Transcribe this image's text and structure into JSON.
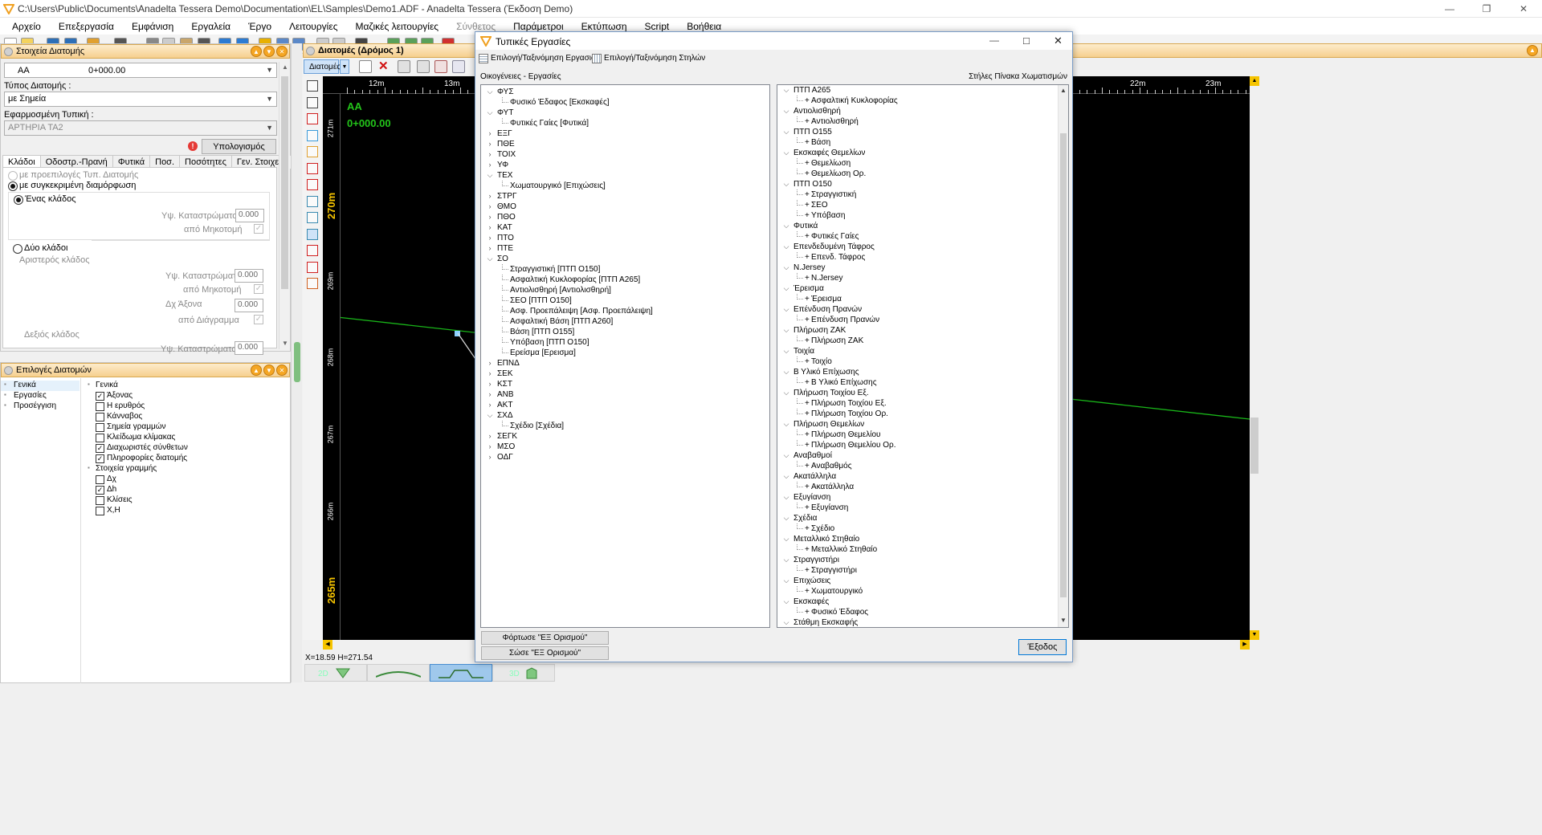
{
  "app": {
    "title": "C:\\Users\\Public\\Documents\\Anadelta Tessera Demo\\Documentation\\EL\\Samples\\Demo1.ADF - Anadelta Tessera (Έκδοση Demo)"
  },
  "menu": [
    {
      "label": "Αρχείο",
      "enabled": true
    },
    {
      "label": "Επεξεργασία",
      "enabled": true
    },
    {
      "label": "Εμφάνιση",
      "enabled": true
    },
    {
      "label": "Εργαλεία",
      "enabled": true
    },
    {
      "label": "Έργο",
      "enabled": true
    },
    {
      "label": "Λειτουργίες",
      "enabled": true
    },
    {
      "label": "Μαζικές λειτουργίες",
      "enabled": true
    },
    {
      "label": "Σύνθετος",
      "enabled": false
    },
    {
      "label": "Παράμετροι",
      "enabled": true
    },
    {
      "label": "Εκτύπωση",
      "enabled": true
    },
    {
      "label": "Script",
      "enabled": true
    },
    {
      "label": "Βοήθεια",
      "enabled": true
    }
  ],
  "left_panel": {
    "header": "Στοιχεία Διατομής",
    "section_name": "ΑΑ",
    "section_station": "0+000.00",
    "type_label": "Τύπος Διατομής :",
    "type_value": "με Σημεία",
    "applied_label": "Εφαρμοσμένη Τυπική :",
    "applied_value": "ΑΡΤΗΡΙΑ ΤΑ2",
    "calc_button": "Υπολογισμός",
    "tabs": [
      "Κλάδοι",
      "Οδοστρ.-Πρανή",
      "Φυτικά",
      "Ποσ.",
      "Ποσότητες",
      "Γεν. Στοιχεία"
    ],
    "opt_default": "με προεπιλογές Τυπ. Διατομής",
    "opt_specific": "με συγκεκριμένη διαμόρφωση",
    "one_branch": "Ένας κλάδος",
    "embankment_height": "Υψ. Καταστρώματος",
    "value_zero": "0.000",
    "from_profile": "από Μηκοτομή",
    "two_branches": "Δύο κλάδοι",
    "left_branch": "Αριστερός κλάδος",
    "dx_axis": "Δχ Άξονα",
    "from_diagram": "από Διάγραμμα",
    "right_branch": "Δεξιός κλάδος"
  },
  "options_panel": {
    "header": "Επιλογές Διατομών",
    "nav": [
      "Γενικά",
      "Εργασίες",
      "Προσέγγιση"
    ],
    "general_title": "Γενικά",
    "general_items": [
      {
        "label": "Άξονας",
        "checked": true
      },
      {
        "label": "Η ερυθρός",
        "checked": false
      },
      {
        "label": "Κάνναβος",
        "checked": false
      },
      {
        "label": "Σημεία γραμμών",
        "checked": false
      },
      {
        "label": "Κλείδωμα κλίμακας",
        "checked": false
      },
      {
        "label": "Διαχωριστές σύνθετων",
        "checked": true
      },
      {
        "label": "Πληροφορίες διατομής",
        "checked": true
      }
    ],
    "line_title": "Στοιχεία γραμμής",
    "line_items": [
      {
        "label": "Δχ",
        "checked": false
      },
      {
        "label": "Δh",
        "checked": true
      },
      {
        "label": "Κλίσεις",
        "checked": false
      },
      {
        "label": "Χ,Η",
        "checked": false
      }
    ]
  },
  "sections_window": {
    "header": "Διατομές (Δρόμος 1)",
    "dropdown": "Διατομές",
    "name": "ΑΑ",
    "station": "0+000.00",
    "ruler_top": [
      "12m",
      "13m",
      "22m",
      "23m"
    ],
    "ruler_left": [
      "271m",
      "270m",
      "269m",
      "268m",
      "267m",
      "266m",
      "265m"
    ],
    "status": "X=18.59  H=271.54",
    "view_tabs": [
      "2D",
      "",
      "",
      "3D"
    ]
  },
  "dialog": {
    "title": "Τυπικές Εργασίες",
    "toolbar": [
      "Επιλογή/Ταξινόμηση Εργασιών",
      "Επιλογή/Ταξινόμηση Στηλών"
    ],
    "left_label": "Οικογένειες - Εργασίες",
    "right_label": "Στήλες Πίνακα Χωματισμών",
    "families": [
      {
        "code": "ΦΥΣ",
        "open": true,
        "children": [
          "Φυσικό Έδαφος   [Εκσκαφές]"
        ]
      },
      {
        "code": "ΦΥΤ",
        "open": true,
        "children": [
          "Φυτικές Γαίες   [Φυτικά]"
        ]
      },
      {
        "code": "ΕΞΓ",
        "open": false,
        "children": []
      },
      {
        "code": "ΠΘΕ",
        "open": false,
        "children": []
      },
      {
        "code": "ΤΟΙΧ",
        "open": false,
        "children": []
      },
      {
        "code": "ΥΦ",
        "open": false,
        "children": []
      },
      {
        "code": "ΤΕΧ",
        "open": true,
        "children": [
          "Χωματουργικό   [Επιχώσεις]"
        ]
      },
      {
        "code": "ΣΤΡΓ",
        "open": false,
        "children": []
      },
      {
        "code": "ΘΜΟ",
        "open": false,
        "children": []
      },
      {
        "code": "ΠΘΟ",
        "open": false,
        "children": []
      },
      {
        "code": "ΚΑΤ",
        "open": false,
        "children": []
      },
      {
        "code": "ΠΤΟ",
        "open": false,
        "children": []
      },
      {
        "code": "ΠΤΕ",
        "open": false,
        "children": []
      },
      {
        "code": "ΣΟ",
        "open": true,
        "children": [
          "Στραγγιστική    [ΠΤΠ Ο150]",
          "Ασφαλτική Κυκλοφορίας    [ΠΤΠ Α265]",
          "Αντιολισθηρή    [Αντιολισθηρή]",
          "ΣΕΟ    [ΠΤΠ Ο150]",
          "Ασφ. Προεπάλειψη    [Ασφ. Προεπάλειψη]",
          "Ασφαλτική Βάση    [ΠΤΠ Α260]",
          "Βάση    [ΠΤΠ Ο155]",
          "Υπόβαση    [ΠΤΠ Ο150]",
          "Ερείσμα    [Ερεισμα]"
        ]
      },
      {
        "code": "ΕΠΝΔ",
        "open": false,
        "children": []
      },
      {
        "code": "ΣΕΚ",
        "open": false,
        "children": []
      },
      {
        "code": "ΚΣΤ",
        "open": false,
        "children": []
      },
      {
        "code": "ΑΝΒ",
        "open": false,
        "children": []
      },
      {
        "code": "ΑΚΤ",
        "open": false,
        "children": []
      },
      {
        "code": "ΣΧΔ",
        "open": true,
        "children": [
          "Σχέδιο   [Σχέδια]"
        ]
      },
      {
        "code": "ΣΕΓΚ",
        "open": false,
        "children": []
      },
      {
        "code": "ΜΣΟ",
        "open": false,
        "children": []
      },
      {
        "code": "ΟΔΓ",
        "open": false,
        "children": []
      }
    ],
    "columns": [
      {
        "name": "ΠΤΠ Α265",
        "children": [
          "Ασφαλτική Κυκλοφορίας"
        ]
      },
      {
        "name": "Αντιολισθηρή",
        "children": [
          "Αντιολισθηρή"
        ]
      },
      {
        "name": "ΠΤΠ Ο155",
        "children": [
          "Βάση"
        ]
      },
      {
        "name": "Εκσκαφές Θεμελίων",
        "children": [
          "Θεμελίωση",
          "Θεμελίωση Ορ."
        ]
      },
      {
        "name": "ΠΤΠ Ο150",
        "children": [
          "Στραγγιστική",
          "ΣΕΟ",
          "Υπόβαση"
        ]
      },
      {
        "name": "Φυτικά",
        "children": [
          "Φυτικές Γαίες"
        ]
      },
      {
        "name": "Επενδεδυμένη Τάφρος",
        "children": [
          "Επενδ. Τάφρος"
        ]
      },
      {
        "name": "N.Jersey",
        "children": [
          "N.Jersey"
        ]
      },
      {
        "name": "Έρεισμα",
        "children": [
          "Έρεισμα"
        ]
      },
      {
        "name": "Επένδυση Πρανών",
        "children": [
          "Επένδυση Πρανών"
        ]
      },
      {
        "name": "Πλήρωση ΖΑΚ",
        "children": [
          "Πλήρωση ΖΑΚ"
        ]
      },
      {
        "name": "Τοιχία",
        "children": [
          "Τοιχίο"
        ]
      },
      {
        "name": "Β Υλικό Επίχωσης",
        "children": [
          "Β Υλικό Επίχωσης"
        ]
      },
      {
        "name": "Πλήρωση Τοιχίου Εξ.",
        "children": [
          "Πλήρωση Τοιχίου Εξ.",
          "Πλήρωση Τοιχίου Ορ."
        ]
      },
      {
        "name": "Πλήρωση Θεμελίων",
        "children": [
          "Πλήρωση Θεμελίου",
          "Πλήρωση Θεμελίου Ορ."
        ]
      },
      {
        "name": "Αναβαθμοί",
        "children": [
          "Αναβαθμός"
        ]
      },
      {
        "name": "Ακατάλληλα",
        "children": [
          "Ακατάλληλα"
        ]
      },
      {
        "name": "Εξυγίανση",
        "children": [
          "Εξυγίανση"
        ]
      },
      {
        "name": "Σχέδια",
        "children": [
          "Σχέδιο"
        ]
      },
      {
        "name": "Μεταλλικό Στηθαίο",
        "children": [
          "Μεταλλικό Στηθαίο"
        ]
      },
      {
        "name": "Στραγγιστήρι",
        "children": [
          "Στραγγιστήρι"
        ]
      },
      {
        "name": "Επιχώσεις",
        "children": [
          "Χωματουργικό"
        ]
      },
      {
        "name": "Εκσκαφές",
        "children": [
          "Φυσικό Έδαφος"
        ]
      },
      {
        "name": "Στάθμη Εκσκαφής",
        "children": []
      }
    ],
    "load_button": "Φόρτωσε \"ΕΞ Ορισμού\"",
    "save_button": "Σώσε \"ΕΞ Ορισμού\"",
    "exit_button": "Έξοδος"
  }
}
